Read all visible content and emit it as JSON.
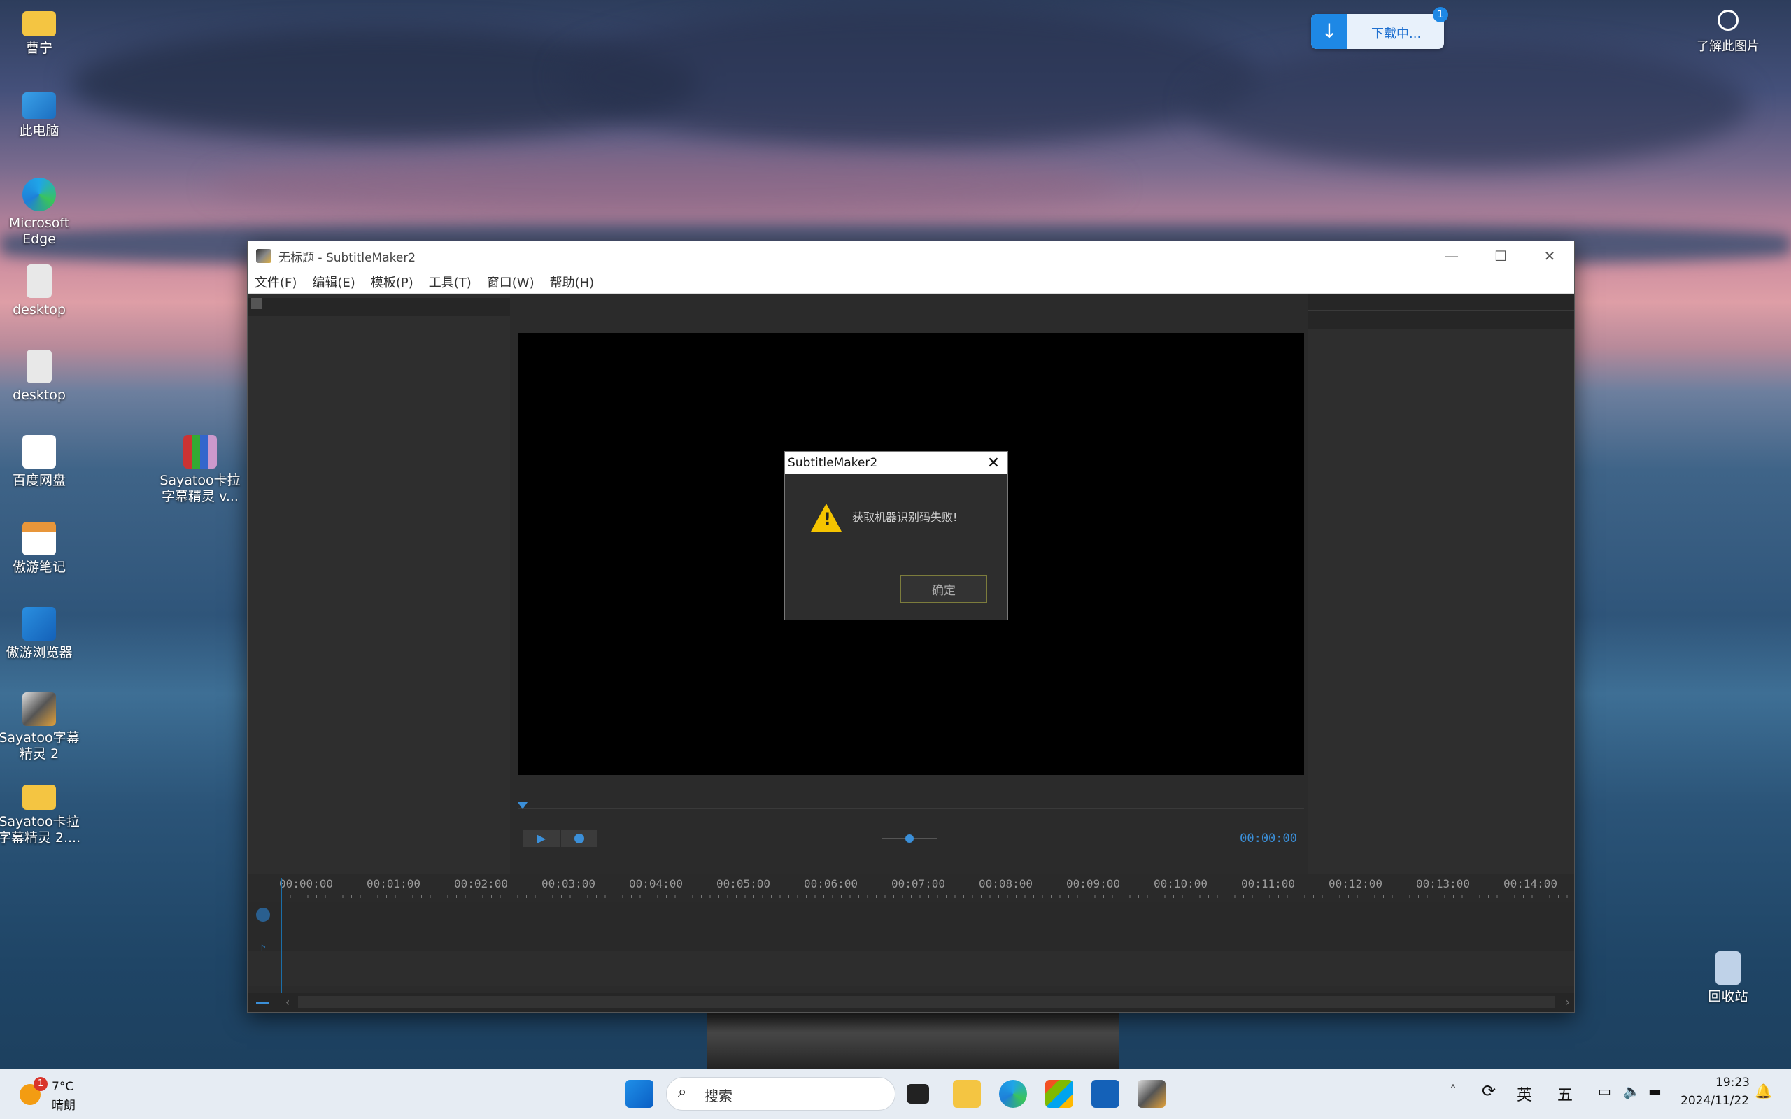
{
  "desktop": {
    "icons": [
      {
        "label": "曹宁"
      },
      {
        "label": "此电脑"
      },
      {
        "label": "Microsoft Edge"
      },
      {
        "label": "desktop"
      },
      {
        "label": "desktop"
      },
      {
        "label": "百度网盘"
      },
      {
        "label": "傲游笔记"
      },
      {
        "label": "傲游浏览器"
      },
      {
        "label": "Sayatoo字幕精灵 2"
      },
      {
        "label": "Sayatoo卡拉字幕精灵 2...."
      },
      {
        "label": "Sayatoo卡拉字幕精灵 v..."
      },
      {
        "label": "回收站"
      }
    ],
    "download_badge": {
      "label": "下载中...",
      "count": "1"
    },
    "learn_picture": {
      "label": "了解此图片"
    }
  },
  "window": {
    "title": "无标题 - SubtitleMaker2",
    "menu": [
      "文件(F)",
      "编辑(E)",
      "模板(P)",
      "工具(T)",
      "窗口(W)",
      "帮助(H)"
    ],
    "time_display": "00:00:00",
    "timeline_ticks": [
      "00:00:00",
      "00:01:00",
      "00:02:00",
      "00:03:00",
      "00:04:00",
      "00:05:00",
      "00:06:00",
      "00:07:00",
      "00:08:00",
      "00:09:00",
      "00:10:00",
      "00:11:00",
      "00:12:00",
      "00:13:00",
      "00:14:00"
    ]
  },
  "dialog": {
    "title": "SubtitleMaker2",
    "message": "获取机器识别码失败!",
    "ok_label": "确定"
  },
  "taskbar": {
    "weather_temp": "7°C",
    "weather_desc": "晴朗",
    "weather_badge": "1",
    "search_placeholder": "搜索",
    "ime_lang": "英",
    "ime_mode": "五",
    "time": "19:23",
    "date": "2024/11/22"
  }
}
